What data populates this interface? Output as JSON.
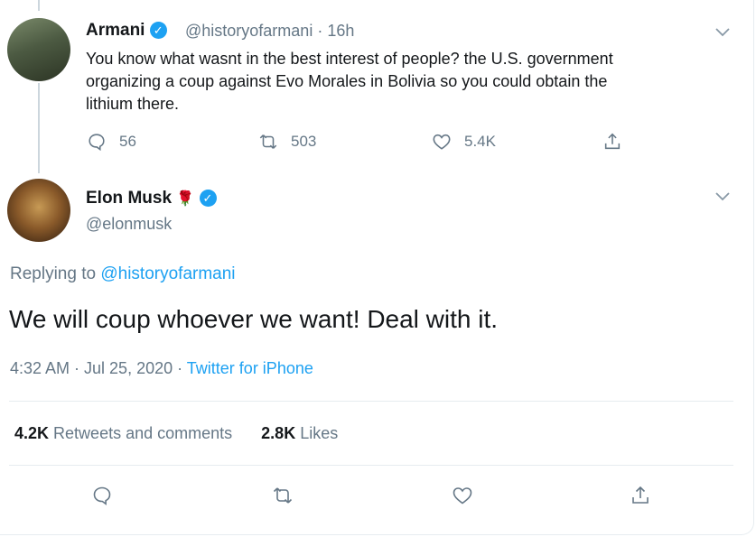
{
  "tweet1": {
    "name": "Armani",
    "handle": "@historyofarmani",
    "time": "· 16h",
    "text_line1": "You know what wasnt in the best interest of people? the U.S. government",
    "text_line2": "organizing a coup against Evo Morales in Bolivia so you could obtain the",
    "text_line3": "lithium there.",
    "replies": "56",
    "retweets": "503",
    "likes": "5.4K"
  },
  "tweet2": {
    "name": "Elon Musk",
    "handle": "@elonmusk",
    "replying_prefix": "Replying to",
    "replying_handle": "@historyofarmani",
    "text": "We will coup whoever we want! Deal with it.",
    "timestamp": "4:32 AM · Jul 25, 2020 ·",
    "source": "Twitter for iPhone",
    "retweets_count": "4.2K",
    "retweets_label": "Retweets and comments",
    "likes_count": "2.8K",
    "likes_label": "Likes"
  },
  "icons": [
    "chevron-down-icon",
    "reply-icon",
    "retweet-icon",
    "like-icon",
    "share-icon",
    "verified-badge-icon",
    "rose-icon"
  ],
  "colors": {
    "accent": "#1da1f2",
    "muted": "#657786",
    "text": "#14171a",
    "border": "#e6ecf0"
  }
}
